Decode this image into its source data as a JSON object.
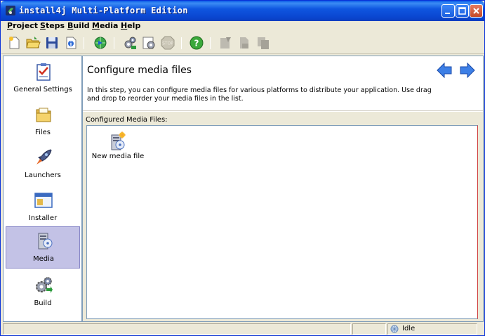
{
  "window": {
    "title": "install4j Multi-Platform Edition",
    "title_bar_color": "#0a46d0"
  },
  "menu": {
    "items": [
      {
        "label": "Project"
      },
      {
        "label": "Steps"
      },
      {
        "label": "Build"
      },
      {
        "label": "Media"
      },
      {
        "label": "Help"
      }
    ]
  },
  "toolbar": {
    "icons": [
      "new-project-icon",
      "open-project-icon",
      "save-icon",
      "properties-icon",
      "web-icon",
      "build-icon",
      "build-settings-icon",
      "stop-icon",
      "help-icon",
      "launcher-icon",
      "media-doc-icon",
      "copy-doc-icon"
    ]
  },
  "sidebar": {
    "selected_color": "#c3c2e6",
    "items": [
      {
        "label": "General Settings",
        "icon": "checklist-icon"
      },
      {
        "label": "Files",
        "icon": "folder-icon"
      },
      {
        "label": "Launchers",
        "icon": "rocket-icon"
      },
      {
        "label": "Installer",
        "icon": "window-icon"
      },
      {
        "label": "Media",
        "icon": "media-server-icon",
        "selected": true
      },
      {
        "label": "Build",
        "icon": "gears-icon"
      }
    ]
  },
  "main": {
    "title": "Configure media files",
    "description": "In this step, you can configure media files for various platforms to distribute your application. Use drag and drop to reorder your media files in the list.",
    "section_label": "Configured Media Files:",
    "media_items": [
      {
        "label": "New media file",
        "icon": "new-media-file-icon"
      }
    ]
  },
  "status": {
    "text": "Idle"
  }
}
